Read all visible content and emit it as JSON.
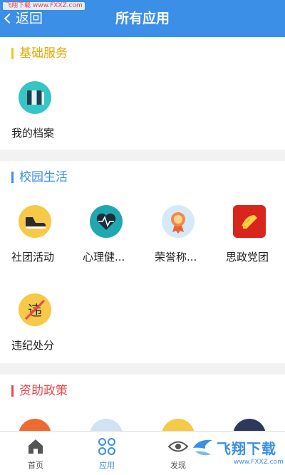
{
  "watermark": "飞翔下载 www.FXXZ.com",
  "header": {
    "back_label": "返回",
    "title": "所有应用"
  },
  "sections": [
    {
      "title": "基础服务",
      "accent": "#f5c518",
      "apps": [
        {
          "label": "我的档案",
          "icon": "folder-binders-icon",
          "color": "#35c5c5"
        }
      ]
    },
    {
      "title": "校园生活",
      "accent": "#3b8fe6",
      "apps": [
        {
          "label": "社团活动",
          "icon": "shoe-icon",
          "color": "#f7c948"
        },
        {
          "label": "心理健...",
          "icon": "heart-pulse-icon",
          "color": "#1fa8b0"
        },
        {
          "label": "荣誉称...",
          "icon": "medal-icon",
          "color": "#d6e9f7"
        },
        {
          "label": "思政党团",
          "icon": "party-emblem-icon",
          "color": "#d9261c"
        },
        {
          "label": "违纪处分",
          "icon": "violation-icon",
          "color": "#f7c948"
        }
      ]
    },
    {
      "title": "资助政策",
      "accent": "#e8484d",
      "apps": [
        {
          "label": "",
          "icon": "policy-1-icon",
          "color": "#ee6a32"
        },
        {
          "label": "",
          "icon": "policy-2-icon",
          "color": "#cfe3f5"
        },
        {
          "label": "",
          "icon": "policy-3-icon",
          "color": "#f7c948"
        },
        {
          "label": "",
          "icon": "policy-4-icon",
          "color": "#2b3a5c"
        }
      ]
    }
  ],
  "tabbar": [
    {
      "label": "首页",
      "icon": "home-icon",
      "active": false
    },
    {
      "label": "应用",
      "icon": "apps-icon",
      "active": true
    },
    {
      "label": "发现",
      "icon": "eye-icon",
      "active": false
    }
  ],
  "brand": {
    "text": "飞翔下载",
    "url": "www.FXXZ.com"
  }
}
